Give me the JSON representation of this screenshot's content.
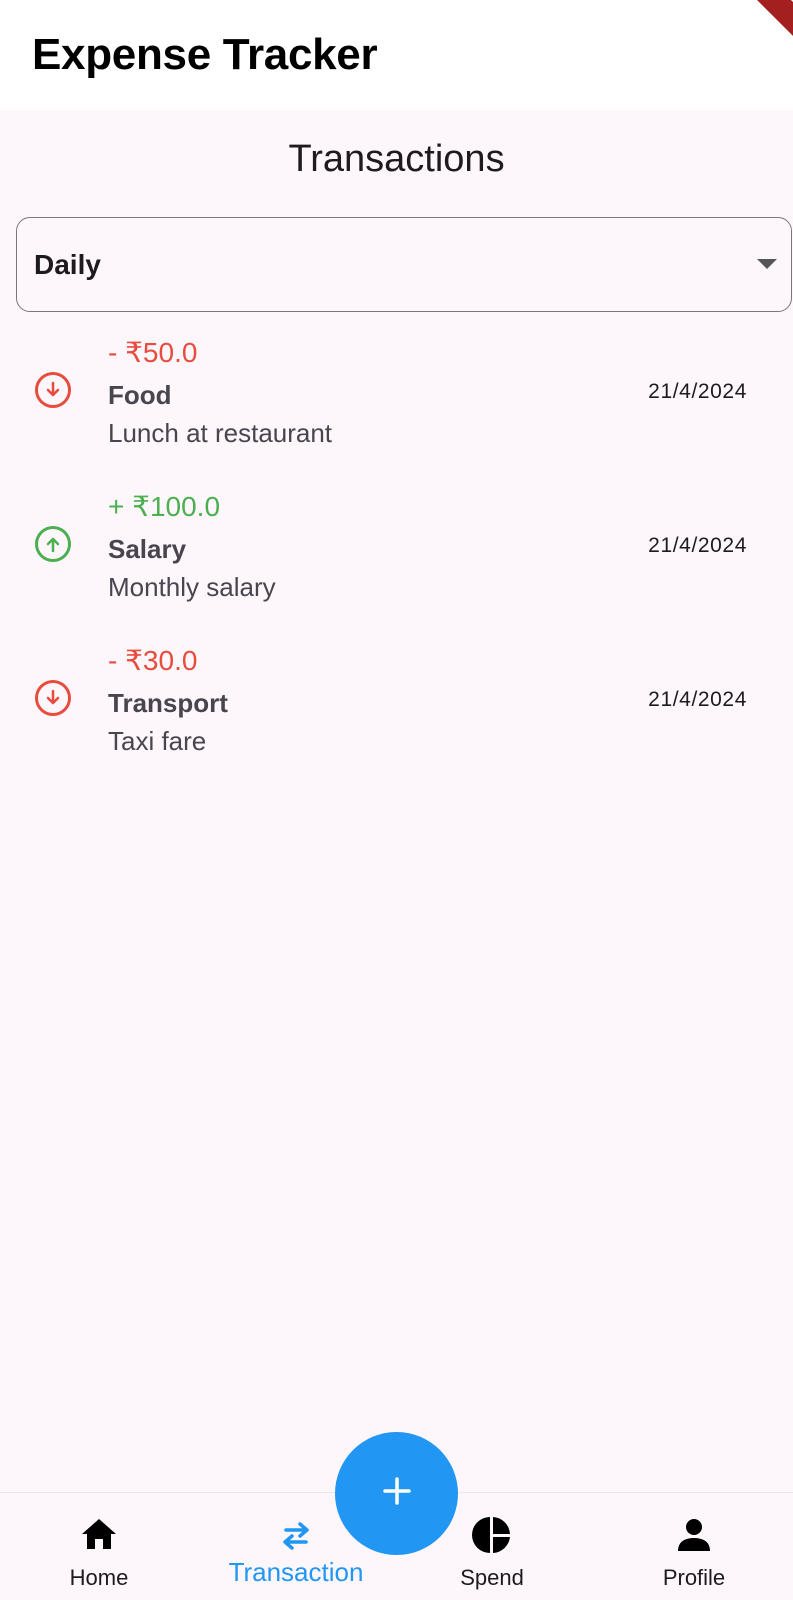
{
  "app": {
    "title": "Expense Tracker"
  },
  "page": {
    "heading": "Transactions"
  },
  "filter": {
    "selected": "Daily"
  },
  "colors": {
    "expense": "#e74c3c",
    "income": "#4caf50",
    "accent": "#2196f3"
  },
  "transactions": [
    {
      "type": "expense",
      "amount": "- ₹50.0",
      "category": "Food",
      "note": "Lunch at restaurant",
      "date": "21/4/2024",
      "icon": "arrow-down-circle-icon"
    },
    {
      "type": "income",
      "amount": "+ ₹100.0",
      "category": "Salary",
      "note": "Monthly salary",
      "date": "21/4/2024",
      "icon": "arrow-up-circle-icon"
    },
    {
      "type": "expense",
      "amount": "- ₹30.0",
      "category": "Transport",
      "note": "Taxi fare",
      "date": "21/4/2024",
      "icon": "arrow-down-circle-icon"
    }
  ],
  "nav": {
    "items": [
      {
        "label": "Home",
        "icon": "home-icon"
      },
      {
        "label": "Transaction",
        "icon": "swap-arrows-icon",
        "active": true
      },
      {
        "label": "Spend",
        "icon": "pie-chart-icon"
      },
      {
        "label": "Profile",
        "icon": "person-icon"
      }
    ]
  },
  "fab": {
    "icon": "plus-icon"
  }
}
